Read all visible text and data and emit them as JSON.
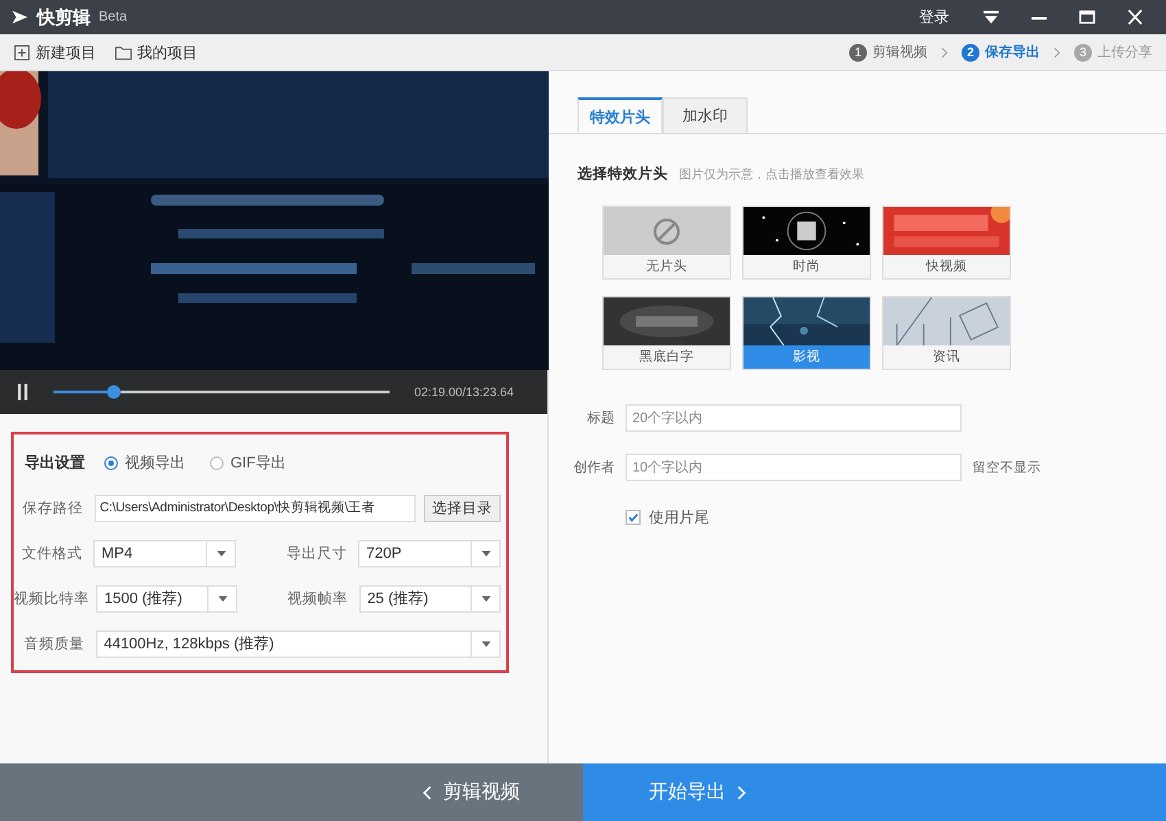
{
  "app": {
    "name": "快剪辑",
    "badge": "Beta",
    "login": "登录"
  },
  "toolbar": [
    {
      "label": "新建项目",
      "kind": "new"
    },
    {
      "label": "我的项目",
      "kind": "folder"
    }
  ],
  "steps": [
    {
      "number": "1",
      "label": "剪辑视频",
      "selected": false,
      "disabled": false
    },
    {
      "number": "2",
      "label": "保存导出",
      "selected": true,
      "disabled": false
    },
    {
      "number": "3",
      "label": "上传分享",
      "selected": false,
      "disabled": true
    }
  ],
  "player": {
    "level": 0.18,
    "time": "02:19.00/13:23.64"
  },
  "export": {
    "heading": "导出设置",
    "modes": [
      {
        "label": "视频导出",
        "selected": true
      },
      {
        "label": "GIF导出",
        "selected": false
      }
    ],
    "path_label": "保存路径",
    "path": "C:\\Users\\Administrator\\Desktop\\快剪辑视频\\王者",
    "browse": "选择目录",
    "fields": [
      {
        "label": "文件格式",
        "value": "MP4",
        "kind": "half"
      },
      {
        "label": "导出尺寸",
        "value": "720P",
        "kind": "half"
      },
      {
        "label": "视频比特率",
        "value": "1500 (推荐)",
        "kind": "half"
      },
      {
        "label": "视频帧率",
        "value": "25 (推荐)",
        "kind": "half"
      },
      {
        "label": "音频质量",
        "value": "44100Hz, 128kbps (推荐)",
        "kind": "full"
      }
    ]
  },
  "tabs": [
    {
      "label": "特效片头",
      "selected": true
    },
    {
      "label": "加水印",
      "selected": false
    }
  ],
  "intro": {
    "title": "选择特效片头",
    "hint": "图片仅为示意，点击播放查看效果",
    "items": [
      {
        "label": "无片头",
        "kind": "none",
        "selected": false
      },
      {
        "label": "时尚",
        "kind": "stars",
        "selected": false
      },
      {
        "label": "快视频",
        "kind": "red",
        "selected": false
      },
      {
        "label": "黑底白字",
        "kind": "dark",
        "selected": false
      },
      {
        "label": "影视",
        "kind": "lightning",
        "selected": true
      },
      {
        "label": "资讯",
        "kind": "lines",
        "selected": false
      }
    ]
  },
  "form": [
    {
      "label": "标题",
      "placeholder": "20个字以内"
    },
    {
      "label": "创作者",
      "placeholder": "10个字以内",
      "note": "留空不显示"
    }
  ],
  "end_card": {
    "label": "使用片尾",
    "checked": true
  },
  "footer": {
    "back": "剪辑视频",
    "next": "开始导出"
  }
}
